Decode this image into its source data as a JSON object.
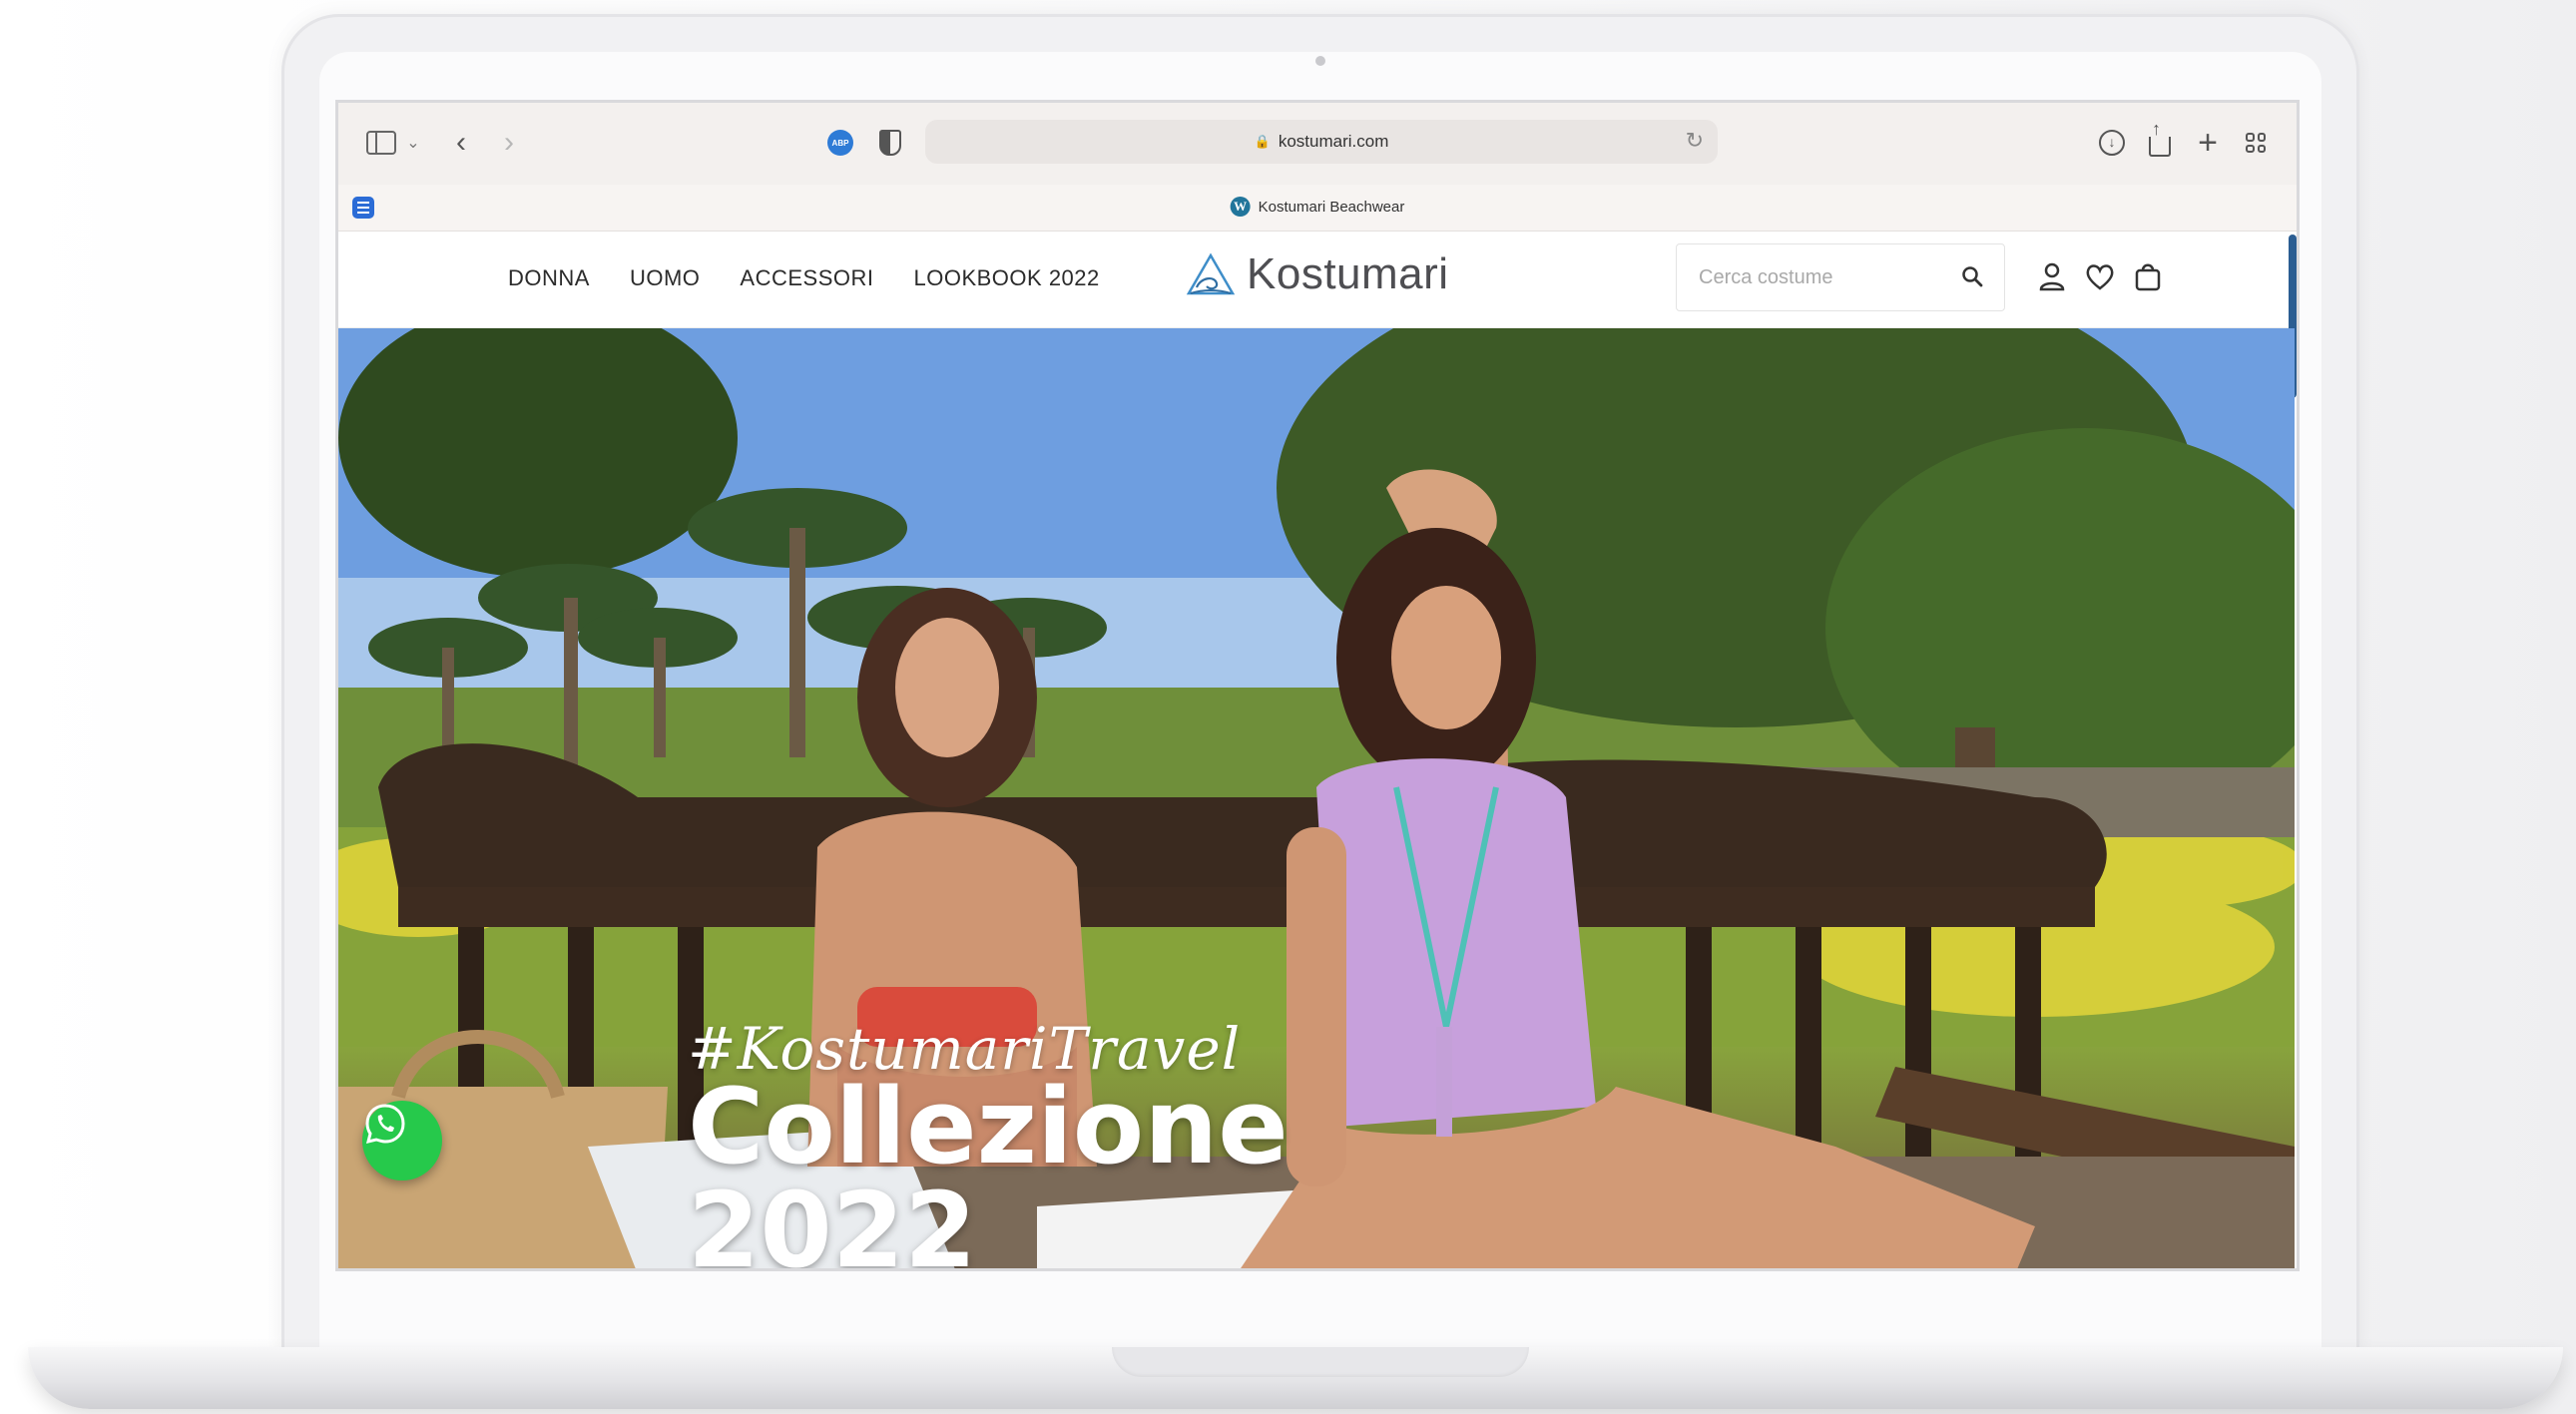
{
  "browser": {
    "url": "kostumari.com",
    "tab_title": "Kostumari Beachwear"
  },
  "site": {
    "nav": [
      "DONNA",
      "UOMO",
      "ACCESSORI",
      "LOOKBOOK 2022"
    ],
    "logo_text": "Kostumari",
    "search_placeholder": "Cerca costume"
  },
  "hero": {
    "tagline": "#KostumariTravel",
    "title_line1": "Collezione",
    "title_line2": "2022"
  },
  "colors": {
    "whatsapp": "#26c94b",
    "accent": "#2b74c8"
  }
}
